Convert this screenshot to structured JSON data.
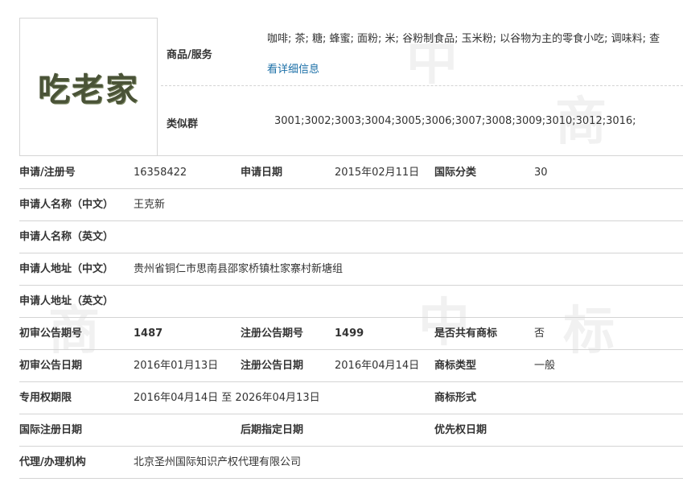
{
  "watermark": {
    "char_a": "中",
    "char_b": "商",
    "char_c": "标"
  },
  "logo": {
    "text": "吃老家"
  },
  "goods": {
    "label": "商品/服务",
    "text": "咖啡; 茶; 糖; 蜂蜜; 面粉; 米; 谷粉制食品; 玉米粉; 以谷物为主的零食小吃; 调味料; 查",
    "link": "看详细信息"
  },
  "similar": {
    "label": "类似群",
    "value": "3001;3002;3003;3004;3005;3006;3007;3008;3009;3010;3012;3016;"
  },
  "rows": {
    "r1": {
      "l1": "申请/注册号",
      "v1": "16358422",
      "l2": "申请日期",
      "v2": "2015年02月11日",
      "l3": "国际分类",
      "v3": "30"
    },
    "r2": {
      "l1": "申请人名称（中文）",
      "v1": "王克新"
    },
    "r3": {
      "l1": "申请人名称（英文）",
      "v1": ""
    },
    "r4": {
      "l1": "申请人地址（中文）",
      "v1": "贵州省铜仁市思南县邵家桥镇杜家寨村新塘组"
    },
    "r5": {
      "l1": "申请人地址（英文）",
      "v1": ""
    },
    "r6": {
      "l1": "初审公告期号",
      "v1": "1487",
      "l2": "注册公告期号",
      "v2": "1499",
      "l3": "是否共有商标",
      "v3": "否"
    },
    "r7": {
      "l1": "初审公告日期",
      "v1": "2016年01月13日",
      "l2": "注册公告日期",
      "v2": "2016年04月14日",
      "l3": "商标类型",
      "v3": "一般"
    },
    "r8": {
      "l1": "专用权期限",
      "v1": "2016年04月14日 至 2026年04月13日",
      "l3": "商标形式",
      "v3": ""
    },
    "r9": {
      "l1": "国际注册日期",
      "v1": "",
      "l2": "后期指定日期",
      "v2": "",
      "l3": "优先权日期",
      "v3": ""
    },
    "r10": {
      "l1": "代理/办理机构",
      "v1": "北京圣州国际知识产权代理有限公司"
    }
  }
}
